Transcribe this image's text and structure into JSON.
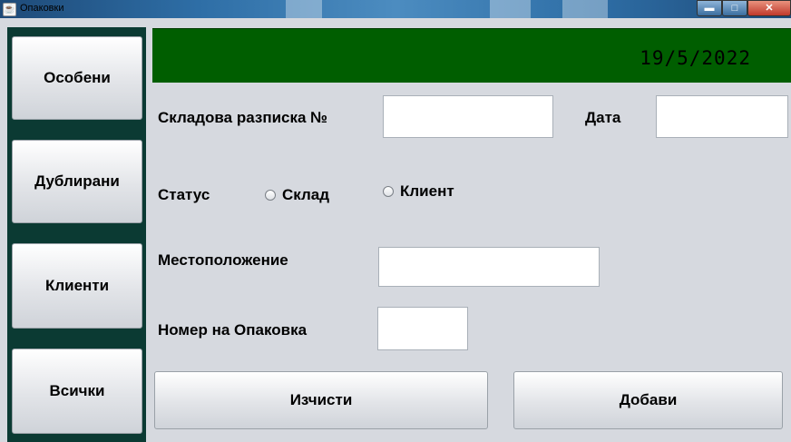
{
  "window": {
    "title": "Опаковки"
  },
  "sidebar": {
    "items": [
      {
        "label": "Особени"
      },
      {
        "label": "Дублирани"
      },
      {
        "label": "Клиенти"
      },
      {
        "label": "Всички"
      }
    ]
  },
  "header": {
    "date": "19/5/2022"
  },
  "form": {
    "receipt_label": "Складова разписка №",
    "receipt_value": "",
    "date_label": "Дата",
    "date_value": "",
    "status_label": "Статус",
    "status_options": [
      {
        "label": "Склад",
        "selected": false
      },
      {
        "label": "Клиент",
        "selected": false
      }
    ],
    "location_label": "Местоположение",
    "location_value": "",
    "package_number_label": "Номер на Опаковка",
    "package_number_value": ""
  },
  "actions": {
    "clear_label": "Изчисти",
    "add_label": "Добави"
  },
  "colors": {
    "header": "#005e00",
    "sidebar": "#0b3a33"
  }
}
